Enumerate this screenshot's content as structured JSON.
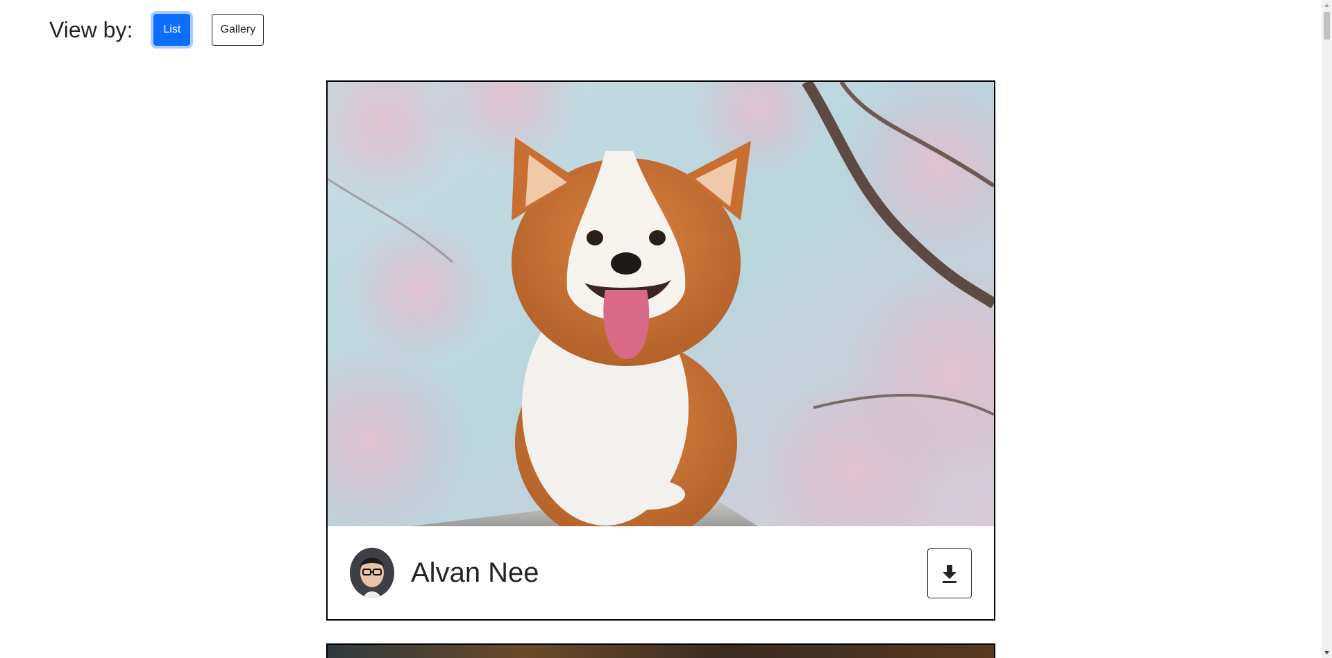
{
  "header": {
    "view_by_label": "View by:",
    "list_button": "List",
    "gallery_button": "Gallery",
    "active_view": "List"
  },
  "cards": [
    {
      "image_description_icon": "corgi-photo",
      "author": {
        "name": "Alvan Nee",
        "avatar_icon": "avatar"
      },
      "download_icon": "download-icon"
    }
  ],
  "colors": {
    "primary": "#0d6efd",
    "text": "#212529",
    "card_border": "#000000"
  }
}
